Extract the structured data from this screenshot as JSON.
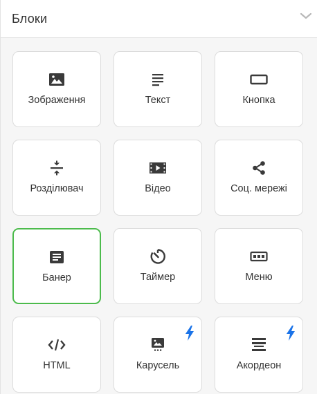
{
  "header": {
    "title": "Блоки",
    "chevron_icon": "chevron-down-icon"
  },
  "blocks": [
    {
      "label": "Зображення",
      "icon": "image-icon",
      "selected": false,
      "bolt": false
    },
    {
      "label": "Текст",
      "icon": "text-lines-icon",
      "selected": false,
      "bolt": false
    },
    {
      "label": "Кнопка",
      "icon": "button-icon",
      "selected": false,
      "bolt": false
    },
    {
      "label": "Розділювач",
      "icon": "divider-icon",
      "selected": false,
      "bolt": false
    },
    {
      "label": "Відео",
      "icon": "video-icon",
      "selected": false,
      "bolt": false
    },
    {
      "label": "Соц. мережі",
      "icon": "share-icon",
      "selected": false,
      "bolt": false
    },
    {
      "label": "Банер",
      "icon": "banner-icon",
      "selected": true,
      "bolt": false
    },
    {
      "label": "Таймер",
      "icon": "timer-icon",
      "selected": false,
      "bolt": false
    },
    {
      "label": "Меню",
      "icon": "menu-icon",
      "selected": false,
      "bolt": false
    },
    {
      "label": "HTML",
      "icon": "code-icon",
      "selected": false,
      "bolt": false
    },
    {
      "label": "Карусель",
      "icon": "carousel-icon",
      "selected": false,
      "bolt": true
    },
    {
      "label": "Акордеон",
      "icon": "accordion-icon",
      "selected": false,
      "bolt": true
    }
  ],
  "colors": {
    "selected_border": "#4cbb4c",
    "bolt": "#1a73e8",
    "icon": "#3a3a3a"
  }
}
